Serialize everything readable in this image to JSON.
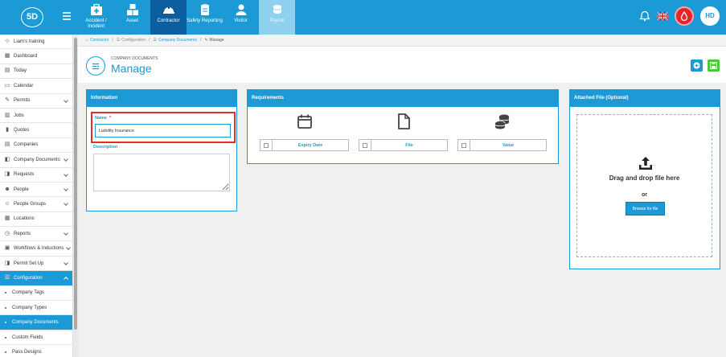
{
  "topbar": {
    "logo": "5D",
    "modules": [
      {
        "label": "Accident / Incident",
        "icon": "first-aid-icon"
      },
      {
        "label": "Asset",
        "icon": "boxes-icon"
      },
      {
        "label": "Contractor",
        "icon": "hard-hat-icon"
      },
      {
        "label": "Safety Reporting",
        "icon": "clipboard-icon"
      },
      {
        "label": "Visitor",
        "icon": "person-icon"
      },
      {
        "label": "Payroll",
        "icon": "coins-icon"
      }
    ],
    "flag_name": "uk-flag-icon",
    "avatar": "HD",
    "colors": {
      "brand": "#1b9ad6",
      "active_module": "#0d5e9e",
      "alert": "#e8232a"
    }
  },
  "sidebar": {
    "items": [
      {
        "label": "Liam's training",
        "icon": "org-icon"
      },
      {
        "label": "Dashboard",
        "icon": "dashboard-icon"
      },
      {
        "label": "Today",
        "icon": "today-icon"
      },
      {
        "label": "Calendar",
        "icon": "calendar-icon"
      },
      {
        "label": "Permits",
        "icon": "permit-icon"
      },
      {
        "label": "Jobs",
        "icon": "jobs-icon"
      },
      {
        "label": "Quotes",
        "icon": "quotes-icon"
      },
      {
        "label": "Companies",
        "icon": "companies-icon"
      },
      {
        "label": "Company Documents",
        "icon": "documents-icon"
      },
      {
        "label": "Requests",
        "icon": "requests-icon"
      },
      {
        "label": "People",
        "icon": "people-icon"
      },
      {
        "label": "People Groups",
        "icon": "people-groups-icon"
      },
      {
        "label": "Locations",
        "icon": "locations-icon"
      },
      {
        "label": "Reports",
        "icon": "reports-icon"
      },
      {
        "label": "Workflows & Inductions",
        "icon": "workflows-icon"
      },
      {
        "label": "Permit Set Up",
        "icon": "permit-setup-icon"
      },
      {
        "label": "Configuration",
        "icon": "configuration-icon"
      },
      {
        "label": "Company Tags"
      },
      {
        "label": "Company Types"
      },
      {
        "label": "Company Documents"
      },
      {
        "label": "Custom Fields"
      },
      {
        "label": "Pass Designs"
      }
    ]
  },
  "breadcrumb": {
    "items": [
      "Contractor",
      "Configuration",
      "Company Documents"
    ],
    "current": "Manage"
  },
  "header": {
    "subtitle": "COMPANY DOCUMENTS",
    "title": "Manage"
  },
  "info_panel": {
    "title": "Information",
    "name_label": "Name",
    "name_required": "*",
    "name_value": "Liability Insurance",
    "description_label": "Description",
    "description_value": ""
  },
  "requirements_panel": {
    "title": "Requirements",
    "options": [
      {
        "label": "Expiry Date",
        "icon": "calendar-icon",
        "checked": false
      },
      {
        "label": "File",
        "icon": "file-icon",
        "checked": false
      },
      {
        "label": "Value",
        "icon": "coins-icon",
        "checked": false
      }
    ]
  },
  "attach_panel": {
    "title": "Attached File (Optional)",
    "drop_text": "Drag and drop file here",
    "or_text": "or",
    "browse_label": "Browse for file"
  }
}
